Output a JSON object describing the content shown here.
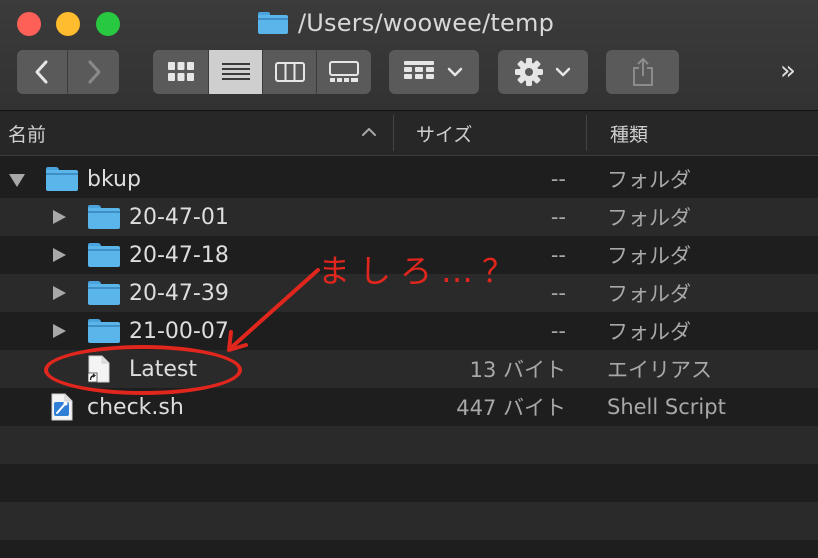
{
  "window": {
    "title": "/Users/woowee/temp"
  },
  "toolbar": {
    "back_icon": "chevron-left-icon",
    "forward_icon": "chevron-right-icon",
    "view_modes": [
      "icon-view",
      "list-view",
      "column-view",
      "gallery-view"
    ],
    "selected_view": "list-view",
    "overflow_label": "»"
  },
  "columns": {
    "name": "名前",
    "size": "サイズ",
    "kind": "種類"
  },
  "rows": [
    {
      "name": "bkup",
      "size": "--",
      "kind": "フォルダ",
      "type": "folder",
      "expanded": true,
      "level": 0
    },
    {
      "name": "20-47-01",
      "size": "--",
      "kind": "フォルダ",
      "type": "folder",
      "expanded": false,
      "level": 1
    },
    {
      "name": "20-47-18",
      "size": "--",
      "kind": "フォルダ",
      "type": "folder",
      "expanded": false,
      "level": 1
    },
    {
      "name": "20-47-39",
      "size": "--",
      "kind": "フォルダ",
      "type": "folder",
      "expanded": false,
      "level": 1
    },
    {
      "name": "21-00-07",
      "size": "--",
      "kind": "フォルダ",
      "type": "folder",
      "expanded": false,
      "level": 1
    },
    {
      "name": "Latest",
      "size": "13 バイト",
      "kind": "エイリアス",
      "type": "alias",
      "level": 1
    },
    {
      "name": "check.sh",
      "size": "447 バイト",
      "kind": "Shell Script",
      "type": "script",
      "level": 0
    }
  ],
  "annotation": {
    "text": "ましろ…？",
    "color": "#e0261d"
  },
  "colors": {
    "folder": "#5ab6ea",
    "close": "#fe5f57",
    "minimize": "#febc2e",
    "zoom": "#28c840"
  }
}
